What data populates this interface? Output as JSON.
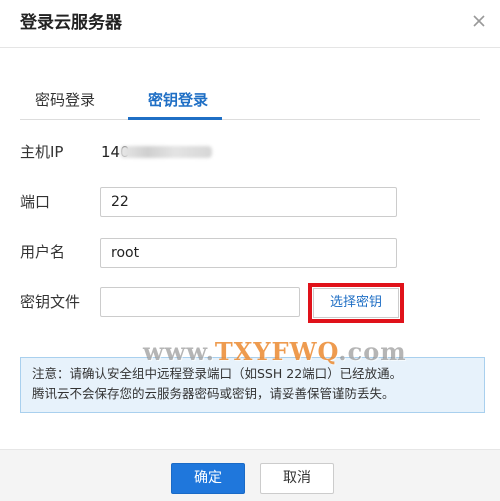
{
  "dialog": {
    "title": "登录云服务器",
    "close_icon": "close-icon"
  },
  "tabs": [
    {
      "label": "密码登录",
      "active": false
    },
    {
      "label": "密钥登录",
      "active": true
    }
  ],
  "form": {
    "host_label": "主机IP",
    "host_value_visible": "140",
    "port_label": "端口",
    "port_value": "22",
    "username_label": "用户名",
    "username_value": "root",
    "keyfile_label": "密钥文件",
    "keyfile_button": "选择密钥"
  },
  "notice": {
    "line1": "注意：请确认安全组中远程登录端口（如SSH 22端口）已经放通。",
    "line2": "腾讯云不会保存您的云服务器密码或密钥，请妥善保管谨防丢失。"
  },
  "watermark": {
    "prefix": "www.",
    "brand": "TXYFWQ",
    "suffix": ".com"
  },
  "footer": {
    "ok_label": "确定",
    "cancel_label": "取消"
  },
  "colors": {
    "accent": "#1f6fc5",
    "primary_button": "#1f77dc",
    "highlight_box": "#e0121a",
    "notice_bg": "#e7f2fb",
    "notice_border": "#a9d0ee"
  }
}
